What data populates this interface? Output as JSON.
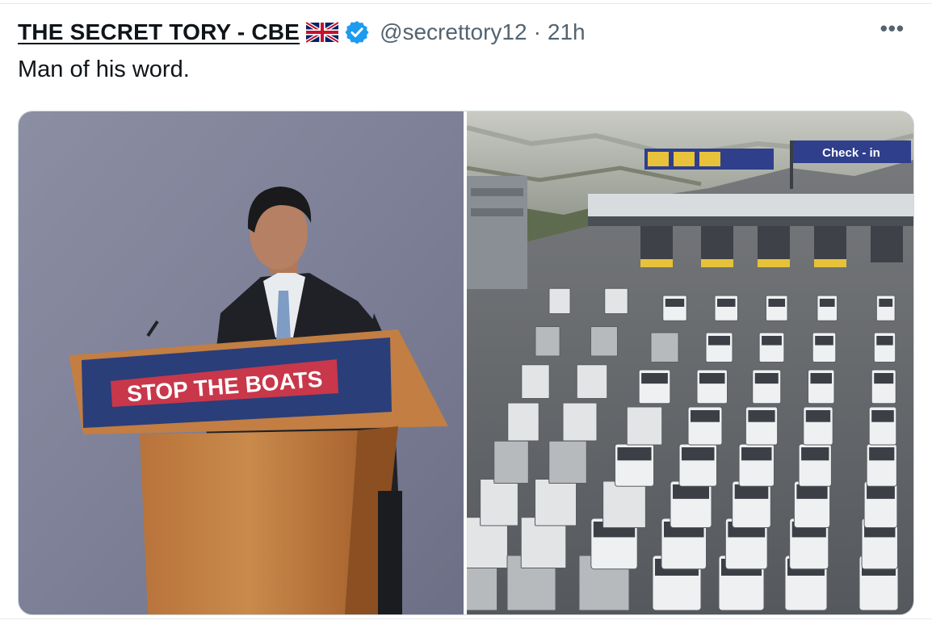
{
  "tweet": {
    "display_name": "THE SECRET TORY - CBE",
    "handle": "@secrettory12",
    "separator": "·",
    "timestamp": "21h",
    "text": "Man of his word.",
    "more_label": "•••"
  },
  "media": {
    "left_photo": {
      "lectern_sign": "STOP THE BOATS"
    },
    "right_photo": {
      "gantry_sign": "Check - in"
    }
  },
  "colors": {
    "verified_blue": "#1d9bf0",
    "secondary_text": "#536471",
    "sign_red": "#c8374a",
    "sign_navy": "#2a3e7a",
    "lectern_wood": "#c07a3c"
  },
  "icons": [
    "union-jack-flag-icon",
    "verified-badge-icon",
    "more-options-icon"
  ]
}
